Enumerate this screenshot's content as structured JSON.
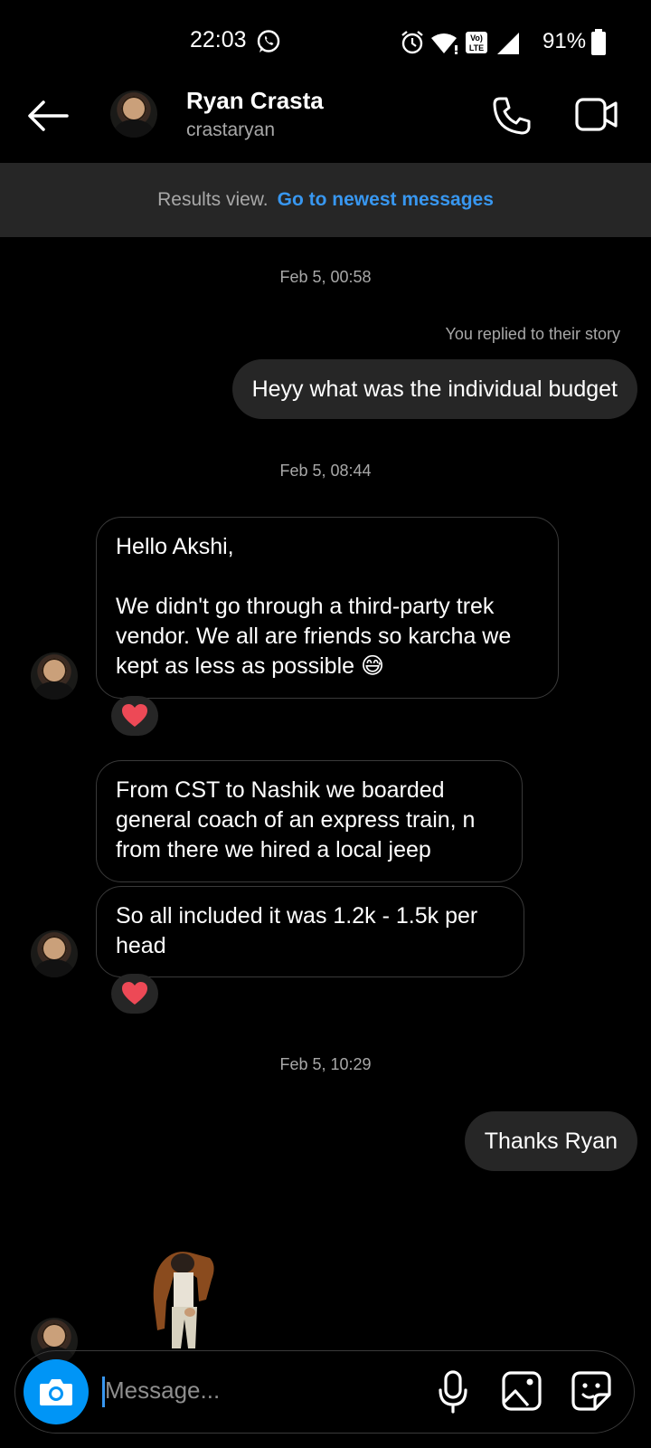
{
  "status_bar": {
    "time": "22:03",
    "battery_percent": "91%",
    "icons": [
      "whatsapp-icon",
      "alarm-icon",
      "wifi-icon",
      "volte-icon",
      "signal-icon",
      "battery-icon"
    ]
  },
  "header": {
    "display_name": "Ryan Crasta",
    "username": "crastaryan",
    "icons": [
      "back-arrow-icon",
      "phone-icon",
      "video-call-icon"
    ]
  },
  "results_bar": {
    "text": "Results view.",
    "link": "Go to newest messages"
  },
  "thread": {
    "timestamp_1": "Feb 5, 00:58",
    "story_note": "You replied to their story",
    "out_msg_1": "Heyy what was the individual budget",
    "timestamp_2": "Feb 5, 08:44",
    "in_msg_1_line1": "Hello Akshi,",
    "in_msg_1_line2": "We didn't go through a third-party trek vendor. We all are friends so karcha we kept as less as possible 😅",
    "in_msg_2": "From CST to Nashik we boarded general coach of an express train, n from there we hired a local jeep",
    "in_msg_3": "So all included it was 1.2k - 1.5k per head",
    "timestamp_3": "Feb 5, 10:29",
    "out_msg_2": "Thanks Ryan"
  },
  "composer": {
    "placeholder": "Message...",
    "icons": [
      "camera-icon",
      "microphone-icon",
      "gallery-icon",
      "sticker-icon"
    ]
  },
  "colors": {
    "accent": "#0095f6",
    "link": "#3897f0",
    "bubble": "#262626",
    "heart": "#ed4956"
  }
}
